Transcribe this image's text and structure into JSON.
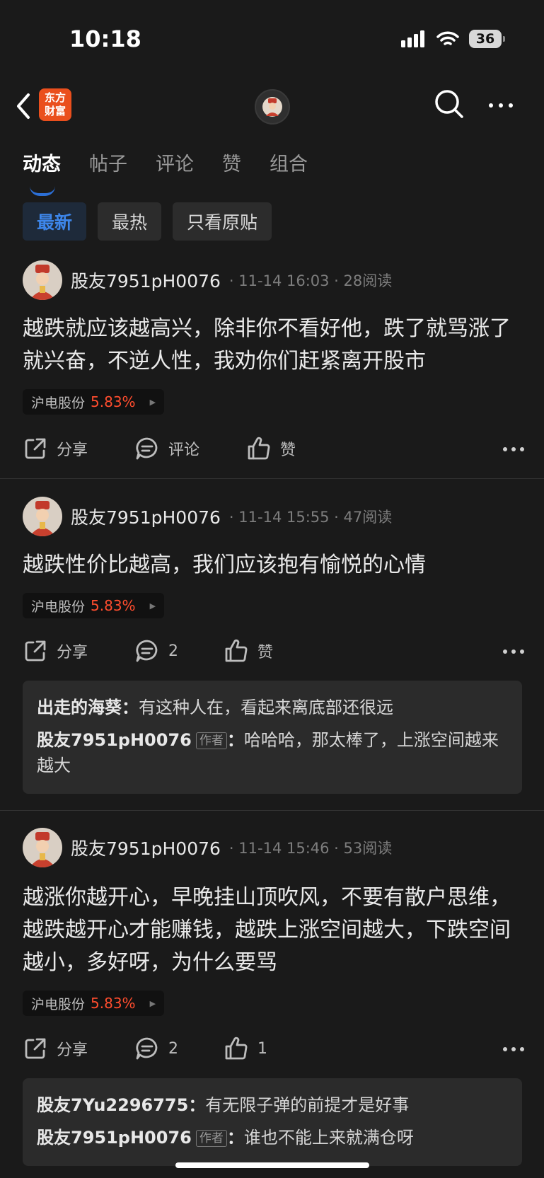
{
  "status_bar": {
    "time": "10:18",
    "battery": "36"
  },
  "nav": {
    "logo_line1": "东方",
    "logo_line2": "财富"
  },
  "tabs": [
    "动态",
    "帖子",
    "评论",
    "赞",
    "组合"
  ],
  "filters": [
    "最新",
    "最热",
    "只看原贴"
  ],
  "posts": [
    {
      "username": "股友7951pH0076",
      "date": "11-14 16:03",
      "reads": "28阅读",
      "content": "越跌就应该越高兴，除非你不看好他，跌了就骂涨了就兴奋，不逆人性，我劝你们赶紧离开股市",
      "stock_name": "沪电股份",
      "stock_pct": "5.83%",
      "share": "分享",
      "comment": "评论",
      "like": "赞",
      "comments": []
    },
    {
      "username": "股友7951pH0076",
      "date": "11-14 15:55",
      "reads": "47阅读",
      "content": "越跌性价比越高，我们应该抱有愉悦的心情",
      "stock_name": "沪电股份",
      "stock_pct": "5.83%",
      "share": "分享",
      "comment": "2",
      "like": "赞",
      "comments": [
        {
          "name": "出走的海葵",
          "text": "有这种人在，看起来离底部还很远"
        },
        {
          "name": "股友7951pH0076",
          "tag": "作者",
          "text": "哈哈哈，那太棒了，上涨空间越来越大"
        }
      ]
    },
    {
      "username": "股友7951pH0076",
      "date": "11-14 15:46",
      "reads": "53阅读",
      "content": "越涨你越开心，早晚挂山顶吹风，不要有散户思维，越跌越开心才能赚钱，越跌上涨空间越大，下跌空间越小，多好呀，为什么要骂",
      "stock_name": "沪电股份",
      "stock_pct": "5.83%",
      "share": "分享",
      "comment": "2",
      "like": "1",
      "comments": [
        {
          "name": "股友7Yu2296775",
          "text": "有无限子弹的前提才是好事"
        },
        {
          "name": "股友7951pH0076",
          "tag": "作者",
          "text": "谁也不能上来就满仓呀"
        }
      ]
    }
  ],
  "colors": {
    "accent": "#2c6fd6",
    "up": "#ff4d2e",
    "logo": "#ea4f1d"
  }
}
